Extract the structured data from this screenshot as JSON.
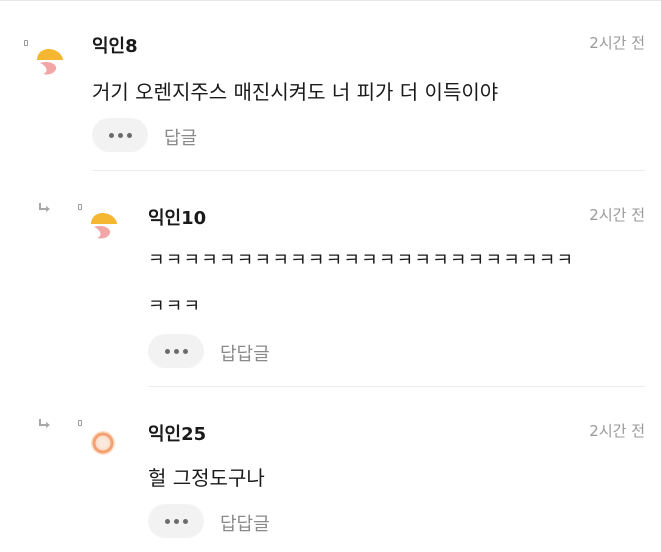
{
  "comments": [
    {
      "name": "익인8",
      "time": "2시간 전",
      "lines": [
        "거기 오렌지주스 매진시켜도 너 피가 더 이득이야"
      ],
      "reply_label": "답글",
      "avatar": "orange-pink-avatar-icon"
    },
    {
      "name": "익인10",
      "time": "2시간 전",
      "lines": [
        "ㅋㅋㅋㅋㅋㅋㅋㅋㅋㅋㅋㅋㅋㅋㅋㅋㅋㅋㅋㅋㅋㅋㅋㅋ",
        "ㅋㅋㅋ"
      ],
      "reply_label": "답답글",
      "avatar": "orange-pink-avatar-icon"
    },
    {
      "name": "익인25",
      "time": "2시간 전",
      "lines": [
        "헐 그정도구나"
      ],
      "reply_label": "답답글",
      "avatar": "orange-ring-avatar-icon"
    }
  ],
  "colors": {
    "avatar_orange": "#f5b731",
    "avatar_pink": "#f2a6a6",
    "ring_orange": "#f4a070",
    "meta_gray": "#9a9a9a",
    "button_bg": "#f2f2f2"
  }
}
